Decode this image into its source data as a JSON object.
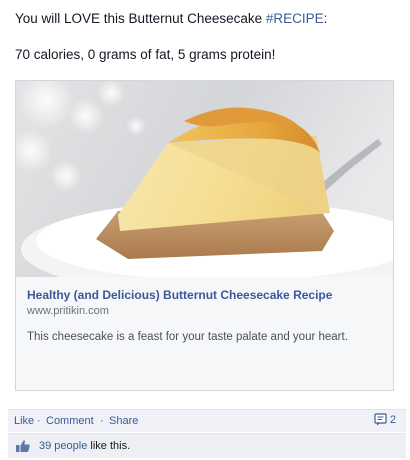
{
  "post": {
    "line1_prefix": "You will LOVE this Butternut Cheesecake ",
    "hashtag": "#RECIPE",
    "line1_suffix": ":",
    "line2": "70 calories, 0 grams of fat, 5 grams protein!"
  },
  "link_card": {
    "title": "Healthy (and Delicious) Butternut Cheesecake Recipe",
    "domain": "www.pritikin.com",
    "description": "This cheesecake is a feast for your taste palate and your heart."
  },
  "actions": {
    "like": "Like",
    "separator": "·",
    "comment": "Comment",
    "share": "Share",
    "comment_count": "2"
  },
  "likes": {
    "people_link": "39 people",
    "suffix": " like this."
  },
  "icons": {
    "comment_count_icon": "comment-bubble-icon",
    "like_icon": "thumbs-up-icon"
  },
  "colors": {
    "link": "#3b5998",
    "action_bar": "#eff1f6"
  }
}
